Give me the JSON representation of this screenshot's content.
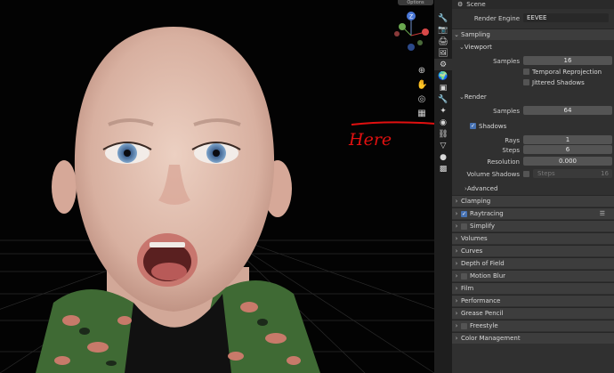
{
  "viewport": {
    "options_label": "Options",
    "gizmo": {
      "z": "Z",
      "y": "Y",
      "x": "X"
    },
    "annotation": "Here"
  },
  "panel": {
    "header": "Scene",
    "render_engine": {
      "label": "Render Engine",
      "value": "EEVEE"
    },
    "sampling": {
      "title": "Sampling",
      "viewport": {
        "title": "Viewport",
        "samples_label": "Samples",
        "samples_value": "16",
        "temporal_reprojection": "Temporal Reprojection",
        "jittered_shadows": "Jittered Shadows"
      },
      "render": {
        "title": "Render",
        "samples_label": "Samples",
        "samples_value": "64",
        "shadows": "Shadows",
        "rays_label": "Rays",
        "rays_value": "1",
        "steps_label": "Steps",
        "steps_value": "6",
        "resolution_label": "Resolution",
        "resolution_value": "0.000",
        "volume_shadows_label": "Volume Shadows",
        "volume_steps_label": "Steps",
        "volume_steps_value": "16"
      },
      "advanced": "Advanced"
    },
    "sections": [
      "Clamping",
      "Raytracing",
      "Simplify",
      "Volumes",
      "Curves",
      "Depth of Field",
      "Motion Blur",
      "Film",
      "Performance",
      "Grease Pencil",
      "Freestyle",
      "Color Management"
    ]
  },
  "colors": {
    "accent": "#4772b3",
    "annotation": "#e11010"
  }
}
